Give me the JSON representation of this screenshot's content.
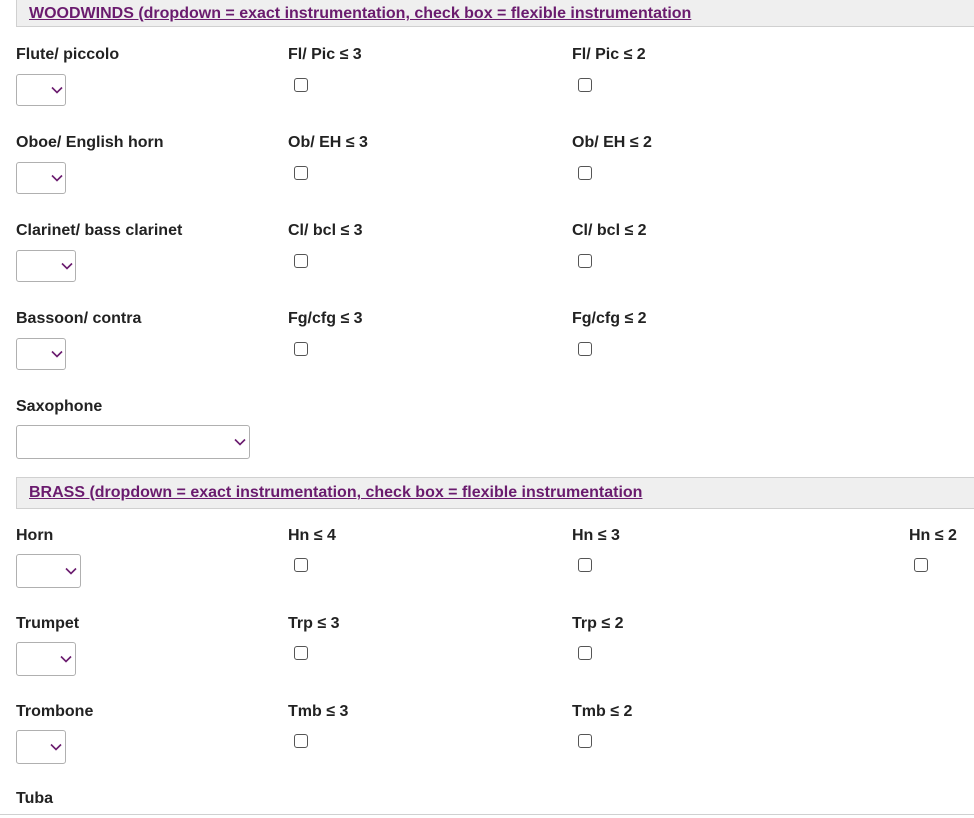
{
  "woodwinds": {
    "header": "WOODWINDS (dropdown = exact instrumentation, check box = flexible instrumentation",
    "flute": {
      "label": "Flute/ piccolo",
      "opt1": "Fl/ Pic ≤ 3",
      "opt2": "Fl/ Pic ≤ 2"
    },
    "oboe": {
      "label": "Oboe/ English horn",
      "opt1": "Ob/ EH ≤ 3",
      "opt2": "Ob/ EH ≤ 2"
    },
    "clarinet": {
      "label": "Clarinet/ bass clarinet",
      "opt1": "Cl/ bcl ≤ 3",
      "opt2": "Cl/ bcl ≤ 2"
    },
    "bassoon": {
      "label": "Bassoon/ contra",
      "opt1": "Fg/cfg ≤ 3",
      "opt2": "Fg/cfg ≤ 2"
    },
    "saxophone": {
      "label": "Saxophone"
    }
  },
  "brass": {
    "header": "BRASS (dropdown = exact instrumentation, check box = flexible instrumentation",
    "horn": {
      "label": "Horn",
      "opt1": "Hn ≤ 4",
      "opt2": "Hn ≤ 3",
      "opt3": "Hn ≤ 2"
    },
    "trumpet": {
      "label": "Trumpet",
      "opt1": "Trp ≤ 3",
      "opt2": "Trp ≤ 2"
    },
    "trombone": {
      "label": "Trombone",
      "opt1": "Tmb ≤ 3",
      "opt2": "Tmb ≤ 2"
    },
    "tuba": {
      "label": "Tuba"
    }
  },
  "colors": {
    "link": "#6a1b6e",
    "header_bg": "#efefef"
  },
  "icons": {
    "dropdown": "chevron-down-icon"
  }
}
